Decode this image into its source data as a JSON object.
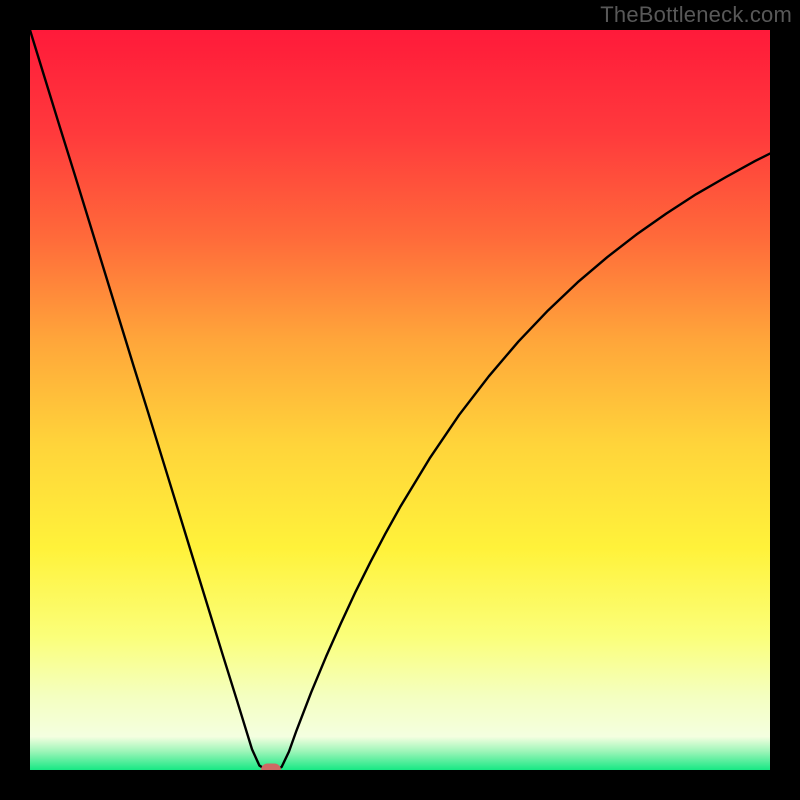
{
  "watermark": "TheBottleneck.com",
  "chart_data": {
    "type": "line",
    "title": "",
    "xlabel": "",
    "ylabel": "",
    "xlim": [
      0,
      100
    ],
    "ylim": [
      0,
      100
    ],
    "background_gradient": {
      "stops": [
        {
          "offset": 0.0,
          "color": "#ff1a3a"
        },
        {
          "offset": 0.14,
          "color": "#ff3a3c"
        },
        {
          "offset": 0.28,
          "color": "#ff6a3a"
        },
        {
          "offset": 0.42,
          "color": "#ffa63a"
        },
        {
          "offset": 0.56,
          "color": "#ffd43a"
        },
        {
          "offset": 0.7,
          "color": "#fff23a"
        },
        {
          "offset": 0.82,
          "color": "#fbff7a"
        },
        {
          "offset": 0.9,
          "color": "#f4ffc0"
        },
        {
          "offset": 0.955,
          "color": "#f4ffe0"
        },
        {
          "offset": 0.975,
          "color": "#9cf5b8"
        },
        {
          "offset": 1.0,
          "color": "#17e884"
        }
      ]
    },
    "series": [
      {
        "name": "bottleneck-curve",
        "color": "#000000",
        "x": [
          0,
          2,
          4,
          6,
          8,
          10,
          12,
          14,
          16,
          18,
          20,
          22,
          24,
          26,
          28,
          30,
          31,
          32,
          33,
          34,
          35,
          36,
          38,
          40,
          42,
          44,
          46,
          48,
          50,
          54,
          58,
          62,
          66,
          70,
          74,
          78,
          82,
          86,
          90,
          94,
          98,
          100
        ],
        "y": [
          100,
          93.5,
          87.0,
          80.6,
          74.1,
          67.6,
          61.1,
          54.6,
          48.2,
          41.7,
          35.2,
          28.7,
          22.2,
          15.7,
          9.3,
          2.8,
          0.6,
          0.0,
          0.0,
          0.4,
          2.5,
          5.3,
          10.5,
          15.3,
          19.8,
          24.1,
          28.1,
          31.9,
          35.5,
          42.1,
          48.0,
          53.2,
          57.9,
          62.1,
          65.9,
          69.3,
          72.4,
          75.2,
          77.8,
          80.1,
          82.3,
          83.3
        ]
      }
    ],
    "marker": {
      "x": 32.5,
      "y": 0,
      "color": "#cf6a64"
    }
  }
}
